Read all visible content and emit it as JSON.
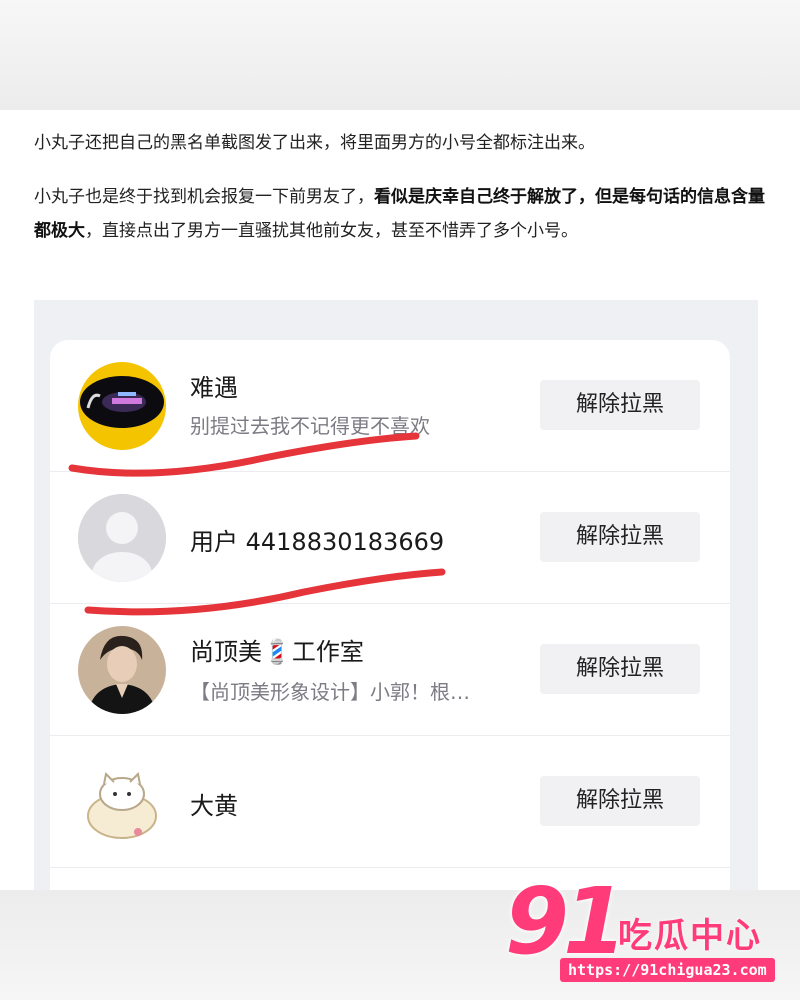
{
  "article": {
    "para1": "小丸子还把自己的黑名单截图发了出来，将里面男方的小号全都标注出来。",
    "para2_a": "小丸子也是终于找到机会报复一下前男友了，",
    "para2_bold": "看似是庆幸自己终于解放了，但是每句话的信息含量都极大",
    "para2_b": "，直接点出了男方一直骚扰其他前女友，甚至不惜弄了多个小号。"
  },
  "blocklist": {
    "items": [
      {
        "name": "难遇",
        "subtitle": "别提过去我不记得更不喜欢",
        "button": "解除拉黑",
        "avatar": "night-photo-avatar"
      },
      {
        "name": "用户 4418830183669",
        "subtitle": "",
        "button": "解除拉黑",
        "avatar": "default-user-avatar"
      },
      {
        "name": "尚顶美💈工作室",
        "subtitle": "【尚顶美形象设计】小郭！根…",
        "button": "解除拉黑",
        "avatar": "man-photo-avatar"
      },
      {
        "name": "大黄",
        "subtitle": "",
        "button": "解除拉黑",
        "avatar": "cartoon-cat-avatar"
      }
    ],
    "highlight_color": "#e5343a"
  },
  "watermark": {
    "number": "91",
    "name": "吃瓜中心",
    "url": "https://91chigua23.com",
    "color": "#ff3b7a"
  }
}
